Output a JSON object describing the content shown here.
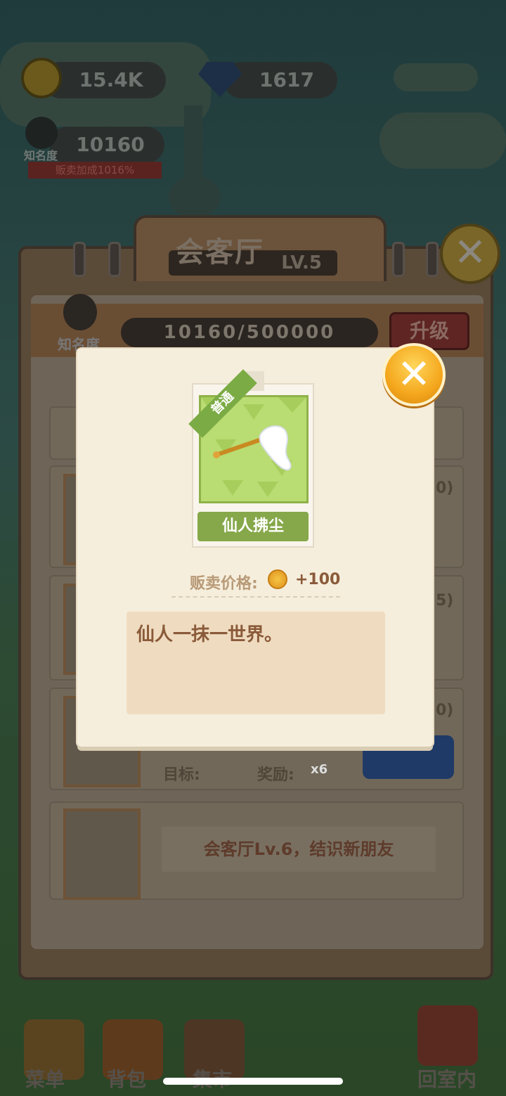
{
  "hud": {
    "coins": "15.4K",
    "gems": "1617",
    "fame_value": "10160",
    "fame_label": "知名度",
    "sell_bonus": "贩卖加成1016%"
  },
  "room_window": {
    "title": "会客厅",
    "level": "LV.5",
    "fame_label": "知名度",
    "progress": "10160/500000",
    "upgrade_label": "升级",
    "rows": [
      {
        "count_suffix": "0)"
      },
      {
        "count_suffix": "5)"
      },
      {
        "count_suffix": "0)",
        "target_label": "目标:",
        "reward_label": "奖励:",
        "reward_count": "x6"
      }
    ],
    "next_unlock": "会客厅Lv.6，结识新朋友"
  },
  "dock": {
    "menu": "菜单",
    "bag": "背包",
    "market": "集市",
    "back": "回室内"
  },
  "item_popup": {
    "rarity": "普通",
    "item_name": "仙人拂尘",
    "price_label": "贩卖价格:",
    "price_value": "+100",
    "description": "仙人一抹一世界。"
  },
  "colors": {
    "popup_bg": "#f6eedc",
    "card_green": "#b9dc73",
    "name_bar_green": "#86a84a",
    "close_gold": "#f4a71d",
    "text_brown": "#8a5a3a"
  },
  "icons": [
    "coin-icon",
    "gem-icon",
    "person-icon",
    "close-icon",
    "whisk-icon"
  ]
}
